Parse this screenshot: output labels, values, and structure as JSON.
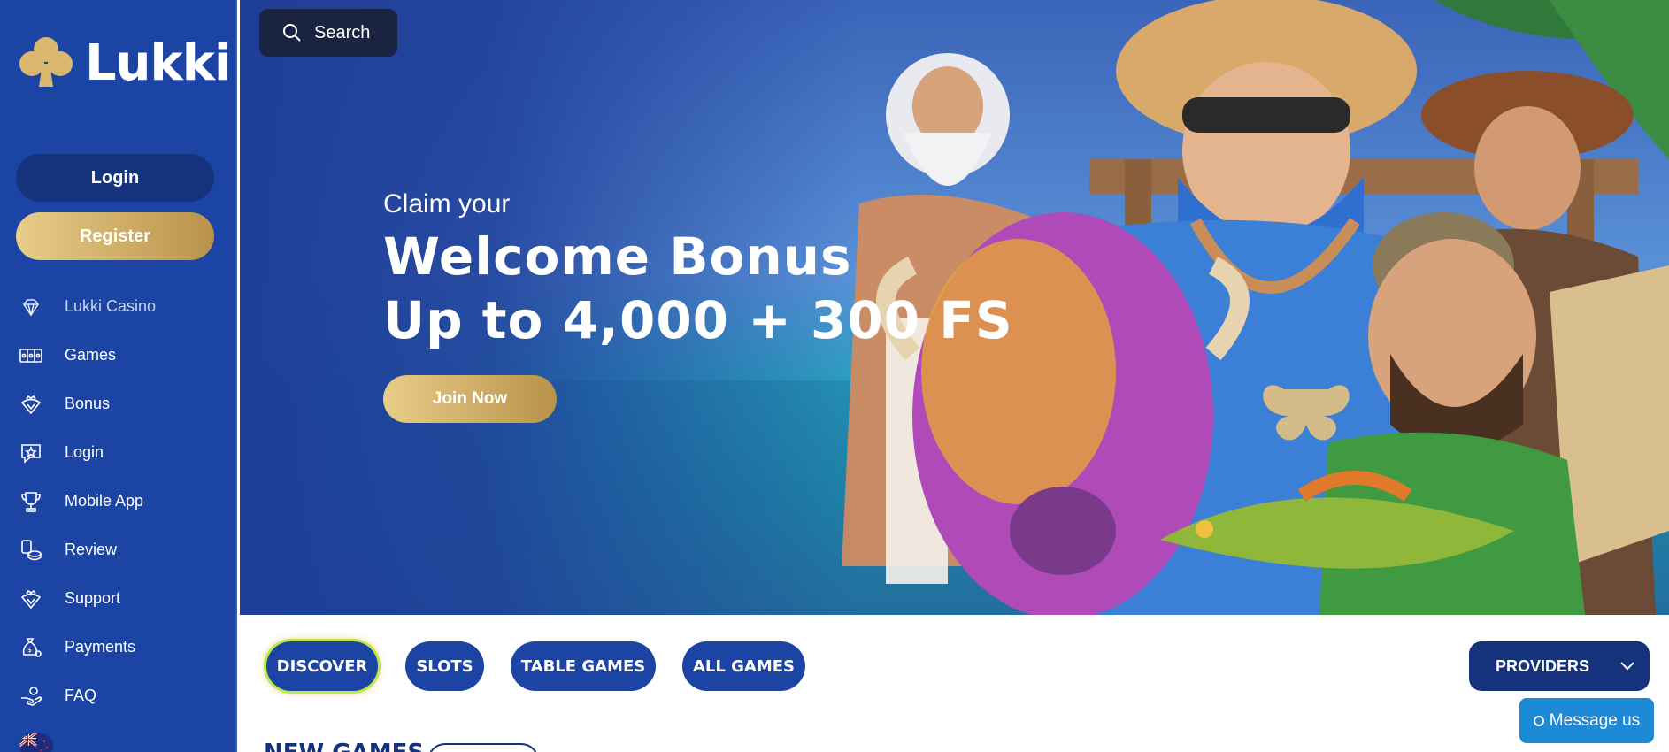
{
  "brand": {
    "name": "Lukki",
    "logo_icon": "clover-icon",
    "accent_gold": "#c9a55e",
    "sidebar_blue": "#1c44a4",
    "dark_blue": "#15327d"
  },
  "sidebar": {
    "login_label": "Login",
    "register_label": "Register",
    "items": [
      {
        "label": "Lukki Casino",
        "icon": "diamond-icon"
      },
      {
        "label": "Games",
        "icon": "slot-machine-icon"
      },
      {
        "label": "Bonus",
        "icon": "crown-badge-icon"
      },
      {
        "label": "Login",
        "icon": "star-bubble-icon"
      },
      {
        "label": "Mobile App",
        "icon": "trophy-icon"
      },
      {
        "label": "Review",
        "icon": "coins-icon"
      },
      {
        "label": "Support",
        "icon": "crown-badge-icon"
      },
      {
        "label": "Payments",
        "icon": "money-bag-icon"
      },
      {
        "label": "FAQ",
        "icon": "hand-coin-icon"
      }
    ],
    "language_icon": "nz-flag-icon"
  },
  "search": {
    "label": "Search"
  },
  "hero": {
    "subtitle": "Claim your",
    "title_line1": "Welcome Bonus",
    "title_line2": "Up to 4,000 + 300 FS",
    "cta_label": "Join Now"
  },
  "categories": [
    {
      "label": "DISCOVER",
      "active": true
    },
    {
      "label": "SLOTS",
      "active": false
    },
    {
      "label": "TABLE GAMES",
      "active": false
    },
    {
      "label": "ALL GAMES",
      "active": false
    }
  ],
  "providers_label": "PROVIDERS",
  "chat": {
    "label": "Message us"
  },
  "section": {
    "title": "NEW GAMES"
  }
}
